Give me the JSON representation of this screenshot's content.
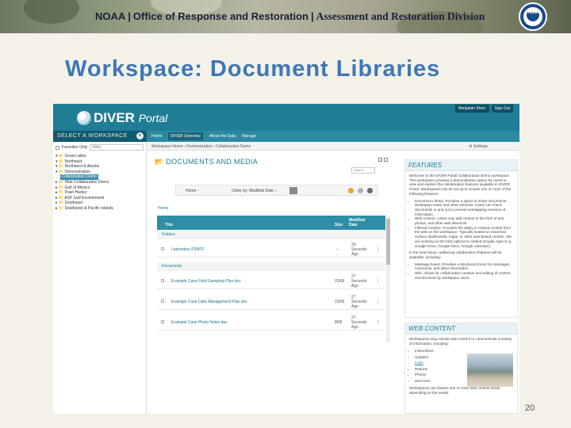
{
  "banner": {
    "org": "NOAA",
    "office": "Office of Response and Restoration",
    "division": "Assessment and Restoration Division",
    "logo_text": "NOAA"
  },
  "slide": {
    "title": "Workspace: Document Libraries",
    "page_number": "20"
  },
  "portal": {
    "logo_main": "DIVER",
    "logo_sub": "Portal",
    "account_buttons": [
      "Benjamin Shorr",
      "Sign Out"
    ],
    "workspace_bar": "SELECT A WORKSPACE",
    "back_glyph": "«",
    "nav": [
      "Home",
      "DIVER Overview",
      "About the Data",
      "Manage"
    ],
    "breadcrumb": "Workspace Home › Demonstration › Collaboration Demo",
    "settings_label": "Settings",
    "favorites_label": "Favorites Only",
    "favorites_placeholder": "Filter",
    "tree": [
      "▾ 📁 Great Lakes",
      "▾ 📁 Northeast",
      "▾ 📁 Northwest & Alaska",
      "  ▾ 📁 Demonstration",
      "    ▾ 📁 Collaboration Demo",
      "    ▸ 📁 Hide Collaboration Demo",
      "▸ 📁 Gulf of Mexico",
      "▸ 📁 Pearl Harbor",
      "▸ 📁 ASP Gulf Environment",
      "▸ 📁 Southeast",
      "▸ 📁 Southwest & Pacific Islands"
    ],
    "selected_tree_item": "Collaboration Demo"
  },
  "docs": {
    "title": "DOCUMENTS AND MEDIA",
    "search_placeholder": "Search",
    "toolbar_home": "Home ↑",
    "toolbar_order": "Order by: Modified Date ↓",
    "home_link": "Home",
    "columns": [
      "Title",
      "Size",
      "Modified Date"
    ],
    "sections": [
      {
        "name": "Folders",
        "rows": [
          {
            "title": "Laboratory PDATF",
            "size": "--",
            "date": [
              "29",
              "Seconds",
              "Ago"
            ]
          }
        ]
      },
      {
        "name": "Documents",
        "rows": [
          {
            "title": "Example Case Field Sampling Plan.doc",
            "size": "22KB",
            "date": [
              "27",
              "Seconds",
              "Ago"
            ]
          },
          {
            "title": "Example Case Data Management Plan.doc",
            "size": "22KB",
            "date": [
              "27",
              "Seconds",
              "Ago"
            ]
          },
          {
            "title": "Example Case Photo Notes.doc",
            "size": "8KB",
            "date": [
              "27",
              "Seconds",
              "Ago"
            ]
          }
        ]
      }
    ]
  },
  "features": {
    "title": "FEATURES",
    "intro": "Welcome to the DIVER Portal Collaboration Demo workspace. This workspace provides a demonstration space for users to view and explore the collaboration features available in DIVER Portal. Workspaces can be set up to include one or more of the following features:",
    "items": [
      "Document Library. Provides a space to share documents. Workspace team and other versions. Users can check documents in and out to prevent overlapping versions of information.",
      "Web content. Users may add content in the form of text, photos, and other web elements.",
      "Filtered Content. Provides the ability to embed content from the web on the workspace. Typically hosted on searched surface dashboards, maps, or other web-based content. We are working on the best options to embed Google Apps (e.g., Google Drive, Google Docs, Google Calendar).",
      "Message board. Provides a structured forum for messages, comments, and other information.",
      "Wiki. Allows for collaborative creation and editing of content and structure by workspace users."
    ],
    "middle": "In the near future, additional collaboration features will be available, including:"
  },
  "web_content": {
    "title": "WEB CONTENT",
    "intro": "Workspaces may include web content to communicate a variety of information, including:",
    "items": [
      "Instructions",
      "Updates",
      "Links",
      "Reports",
      "Photos",
      "and more"
    ],
    "link_item": "Links",
    "outro": "Workspaces can feature one or more web content areas, depending on the needs."
  },
  "colors": {
    "title_blue": "#3f76b7",
    "portal_teal": "#1f7d95",
    "header_teal": "#2e8ea8"
  }
}
